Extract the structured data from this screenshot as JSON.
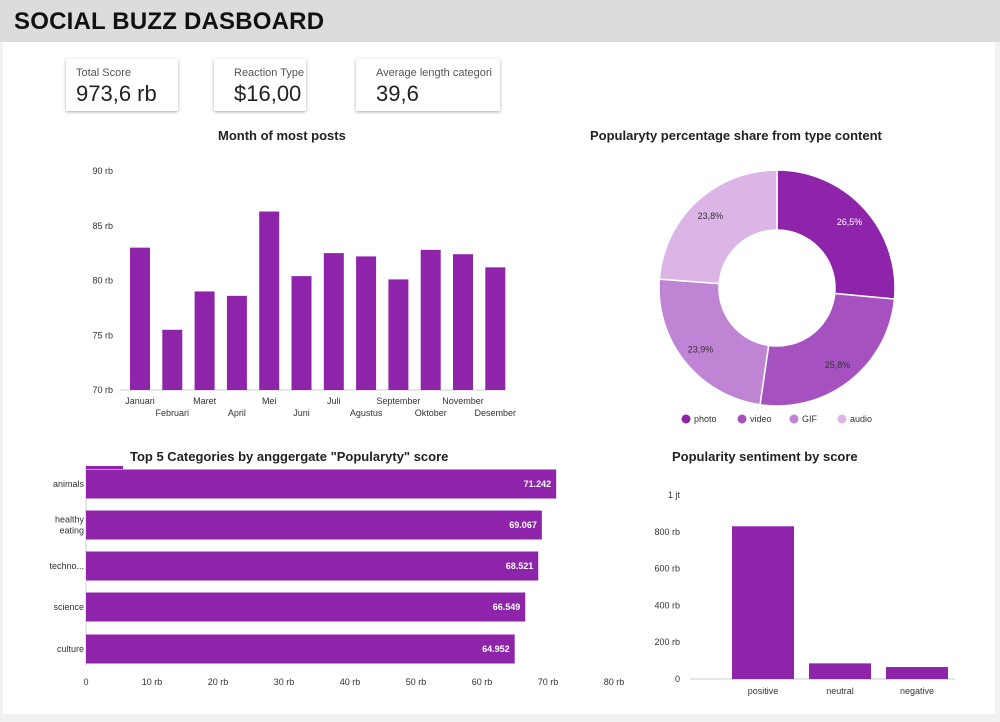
{
  "header": {
    "title": "SOCIAL BUZZ DASBOARD"
  },
  "scorecards": [
    {
      "label": "Total Score",
      "value": "973,6 rb"
    },
    {
      "label": "Reaction Type",
      "value": "$16,00"
    },
    {
      "label": "Average length categori",
      "value": "39,6"
    }
  ],
  "colors": {
    "primary": "#8e24aa",
    "photo": "#8e24aa",
    "video": "#a552c0",
    "gif": "#bf84d4",
    "audio": "#dbb5e6",
    "axis": "#cccccc"
  },
  "chart_data": [
    {
      "id": "monthly",
      "type": "bar",
      "title": "Month of most posts",
      "categories": [
        "Januari",
        "Februari",
        "Maret",
        "April",
        "Mei",
        "Juni",
        "Juli",
        "Agustus",
        "September",
        "Oktober",
        "November",
        "Desember"
      ],
      "values": [
        83000,
        75500,
        79000,
        78600,
        86300,
        80400,
        82500,
        82200,
        80100,
        82800,
        82400,
        81200
      ],
      "ylim": [
        70000,
        90000
      ],
      "yticks": [
        "70 rb",
        "75 rb",
        "80 rb",
        "85 rb",
        "90 rb"
      ]
    },
    {
      "id": "donut",
      "type": "pie",
      "title": "Popularyty percentage share from type content",
      "labels": [
        "photo",
        "video",
        "GIF",
        "audio"
      ],
      "values": [
        26.5,
        25.8,
        23.9,
        23.8
      ],
      "value_labels": [
        "26,5%",
        "25,8%",
        "23,9%",
        "23,8%"
      ],
      "legend_position": "bottom"
    },
    {
      "id": "categories",
      "type": "bar",
      "orientation": "horizontal",
      "title": "Top 5 Categories by anggergate  \"Popularyty\" score",
      "categories": [
        [
          "animals"
        ],
        [
          "healthy",
          "eating"
        ],
        [
          "techno..."
        ],
        [
          "science"
        ],
        [
          "culture"
        ]
      ],
      "values": [
        71242,
        69067,
        68521,
        66549,
        64952
      ],
      "value_labels": [
        "71.242",
        "69.067",
        "68.521",
        "66.549",
        "64.952"
      ],
      "xlim": [
        0,
        80000
      ],
      "xticks": [
        "0",
        "10 rb",
        "20 rb",
        "30 rb",
        "40 rb",
        "50 rb",
        "60 rb",
        "70 rb",
        "80 rb"
      ]
    },
    {
      "id": "sentiment",
      "type": "bar",
      "title": "Popularity sentiment by score",
      "categories": [
        "positive",
        "neutral",
        "negative"
      ],
      "values": [
        830000,
        85000,
        65000
      ],
      "ylim": [
        0,
        1000000
      ],
      "yticks": [
        "0",
        "200 rb",
        "400 rb",
        "600 rb",
        "800 rb",
        "1 jt"
      ]
    }
  ]
}
